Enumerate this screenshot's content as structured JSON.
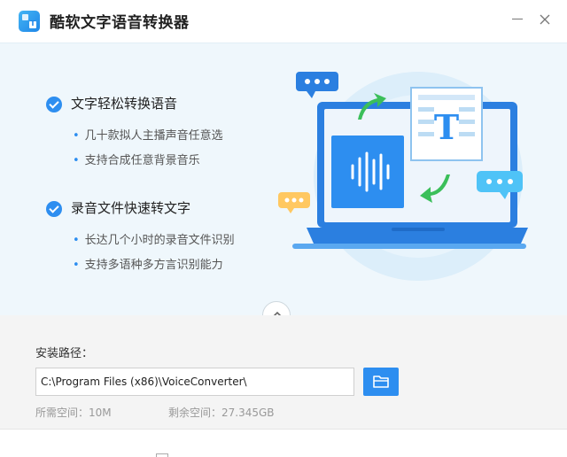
{
  "app": {
    "title": "酷软文字语音转换器",
    "icon": "app-logo-icon"
  },
  "window": {
    "minimize_icon": "minimize-icon",
    "close_icon": "close-icon"
  },
  "features": [
    {
      "title": "文字轻松转换语音",
      "bullets": [
        "几十款拟人主播声音任意选",
        "支持合成任意背景音乐"
      ]
    },
    {
      "title": "录音文件快速转文字",
      "bullets": [
        "长达几个小时的录音文件识别",
        "支持多语种多方言识别能力"
      ]
    }
  ],
  "install": {
    "path_label": "安装路径：",
    "path_value": "C:\\Program Files (x86)\\VoiceConverter\\",
    "browse_icon": "folder-icon",
    "required_space": "所需空间：10M",
    "free_space": "剩余空间：27.345GB"
  },
  "colors": {
    "accent": "#2d8ef0",
    "hero_bg": "#eff7fc",
    "install_bg": "#f4f4f4"
  }
}
